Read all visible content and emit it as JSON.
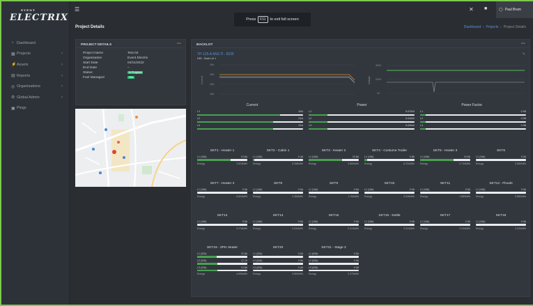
{
  "app": {
    "logo_text": "ELECTRIX",
    "logo_sub": "EVENT"
  },
  "topbar": {
    "user": "Paul Bram"
  },
  "toast": {
    "before": "Press",
    "key": "F11",
    "after": "to exit full screen"
  },
  "sidebar": {
    "items": [
      {
        "label": "Dashboard",
        "icon": "dashboard-icon",
        "chev": false
      },
      {
        "label": "Projects",
        "icon": "projects-icon",
        "chev": true
      },
      {
        "label": "Assets",
        "icon": "assets-icon",
        "chev": true
      },
      {
        "label": "Reports",
        "icon": "reports-icon",
        "chev": true
      },
      {
        "label": "Organisations",
        "icon": "organisations-icon",
        "chev": true
      },
      {
        "label": "Global Admin",
        "icon": "global-admin-icon",
        "chev": true
      },
      {
        "label": "Pings",
        "icon": "pings-icon",
        "chev": false
      }
    ]
  },
  "page": {
    "title": "Project Details",
    "crumbs": [
      "Dashboard",
      "Projects",
      "Project Details"
    ]
  },
  "details": {
    "title": "PROJECT DETAILS",
    "rows": [
      {
        "k": "Project Name",
        "v": "Test 03"
      },
      {
        "k": "Organisation",
        "v": "Event Electrix"
      },
      {
        "k": "Start Date",
        "v": "04/11/2022"
      },
      {
        "k": "End Date",
        "v": "–"
      },
      {
        "k": "Status",
        "v": "In Progress",
        "pill": true
      },
      {
        "k": "Fuel Managed",
        "v": "Yes",
        "pill": true
      }
    ]
  },
  "backlot": {
    "title": "BACKLOT",
    "device": "TP-125-A MULTI - 8235",
    "device_sub": "DB1 - Back Lot 1",
    "current_chart": {
      "ylabel": "Current",
      "yticks": [
        "30A",
        "25A",
        "20A",
        "15A"
      ]
    },
    "voltage_chart": {
      "ylabel": "Voltage",
      "yticks": [
        "300V",
        "200V",
        "0V"
      ]
    },
    "meters": {
      "headers": [
        "Current",
        "Power",
        "Power Factor"
      ],
      "current": [
        {
          "l": "L1",
          "v": "26A",
          "p": 0.78
        },
        {
          "l": "L2",
          "v": "24A",
          "p": 0.72
        },
        {
          "l": "L3",
          "v": "24A",
          "p": 0.72
        }
      ],
      "power": [
        {
          "l": "L1",
          "v": "5.67kW",
          "p": 0.18
        },
        {
          "l": "L2",
          "v": "5.63kW",
          "p": 0.18
        },
        {
          "l": "L3",
          "v": "5.63kW",
          "p": 0.18
        }
      ],
      "pf": [
        {
          "l": "L1",
          "v": "0.98",
          "p": 0.05
        },
        {
          "l": "L2",
          "v": "0.98",
          "p": 0.05
        },
        {
          "l": "L3",
          "v": "0.98",
          "p": 0.05
        }
      ]
    }
  },
  "sockets": [
    {
      "name": "SKT1 - Heater 1",
      "lines": [
        {
          "l": "L1 (16A)",
          "v": "10.6A",
          "p": 0.66
        }
      ],
      "energy": "2.824kWh"
    },
    {
      "name": "SKT2 - Cabin 1",
      "lines": [
        {
          "l": "L1 (16A)",
          "v": "0.4A",
          "p": 0.03
        }
      ],
      "energy": "5.286kWh"
    },
    {
      "name": "SKT3 - Heater 2",
      "lines": [
        {
          "l": "L1 (16A)",
          "v": "10.6A",
          "p": 0.66
        }
      ],
      "energy": "3.660kWh"
    },
    {
      "name": "SKT4 - Costume Trailer",
      "lines": [
        {
          "l": "L1 (16A)",
          "v": "0.8A",
          "p": 0.05
        }
      ],
      "energy": "8.234kWh"
    },
    {
      "name": "SKT5 - Heater 3",
      "lines": [
        {
          "l": "L1 (16A)",
          "v": "10.6A",
          "p": 0.66
        }
      ],
      "energy": "0.744kWh"
    },
    {
      "name": "SKT6",
      "lines": [
        {
          "l": "L1 (16A)",
          "v": "0.0A",
          "p": 0
        }
      ],
      "energy": "9.880kWh"
    },
    {
      "name": "SKT7 - Heater 3",
      "lines": [
        {
          "l": "L1 (16A)",
          "v": "0.0A",
          "p": 0
        }
      ],
      "energy": "6.824kWh"
    },
    {
      "name": "SKT8",
      "lines": [
        {
          "l": "L1 (16A)",
          "v": "0.0A",
          "p": 0
        }
      ],
      "energy": "2.360kWh"
    },
    {
      "name": "SKT9",
      "lines": [
        {
          "l": "L1 (16A)",
          "v": "0.0A",
          "p": 0
        }
      ],
      "energy": "1.760kWh"
    },
    {
      "name": "SKT10",
      "lines": [
        {
          "l": "L1 (16A)",
          "v": "0.0A",
          "p": 0
        }
      ],
      "energy": "0.026kWh"
    },
    {
      "name": "SKT11",
      "lines": [
        {
          "l": "L1 (16A)",
          "v": "0.0A",
          "p": 0
        }
      ],
      "energy": "1.880kWh"
    },
    {
      "name": "SKT12 - Floods",
      "lines": [
        {
          "l": "L1 (16A)",
          "v": "0.0A",
          "p": 0
        }
      ],
      "energy": "5.880kWh"
    },
    {
      "name": "SKT13",
      "lines": [
        {
          "l": "L1 (16A)",
          "v": "0.0A",
          "p": 0
        }
      ],
      "energy": "0.076kWh"
    },
    {
      "name": "SKT14",
      "lines": [
        {
          "l": "L1 (16A)",
          "v": "0.0A",
          "p": 0
        }
      ],
      "energy": "0.034kWh"
    },
    {
      "name": "SKT15",
      "lines": [
        {
          "l": "L1 (16A)",
          "v": "0.0A",
          "p": 0
        }
      ],
      "energy": "0.024kWh"
    },
    {
      "name": "SKT16 - Kettle",
      "lines": [
        {
          "l": "L1 (16A)",
          "v": "0.0A",
          "p": 0
        }
      ],
      "energy": "0.024kWh"
    },
    {
      "name": "SKT17",
      "lines": [
        {
          "l": "L1 (16A)",
          "v": "0.0A",
          "p": 0
        }
      ],
      "energy": "0.034kWh"
    },
    {
      "name": "SKT18",
      "lines": [
        {
          "l": "L1 (16A)",
          "v": "0.0A",
          "p": 0
        }
      ],
      "energy": "0.034kWh"
    },
    {
      "name": "SKT19 - 3PH Heater",
      "lines": [
        {
          "l": "L1 (32A)",
          "v": "12.6A",
          "p": 0.39
        },
        {
          "l": "L2 (32A)",
          "v": "12.7A",
          "p": 0.4
        },
        {
          "l": "L3 (32A)",
          "v": "12.8A",
          "p": 0.4
        }
      ],
      "energy": "4.650kWh"
    },
    {
      "name": "SKT20",
      "lines": [
        {
          "l": "L1 (32A)",
          "v": "0.0A",
          "p": 0
        },
        {
          "l": "L2 (32A)",
          "v": "0.0A",
          "p": 0
        },
        {
          "l": "L3 (32A)",
          "v": "0.0A",
          "p": 0
        }
      ],
      "energy": "3.560kWh"
    },
    {
      "name": "SKT21 - Stage 2",
      "lines": [
        {
          "l": "L1 (63A)",
          "v": "0.0A",
          "p": 0
        },
        {
          "l": "L2 (63A)",
          "v": "0.0A",
          "p": 0
        },
        {
          "l": "L3 (63A)",
          "v": "0.0A",
          "p": 0
        }
      ],
      "energy": "3.370kWh"
    }
  ],
  "labels": {
    "energy": "Energy"
  }
}
